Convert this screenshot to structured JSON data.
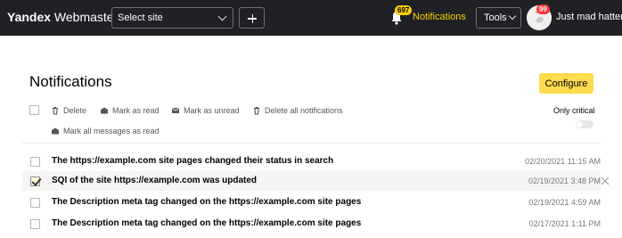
{
  "header": {
    "brand_bold": "Yandex",
    "brand_rest": " Webmaster",
    "site_select_label": "Select site",
    "notifications_count": "697",
    "notifications_label": "Notifications",
    "tools_label": "Tools",
    "avatar_badge": "99",
    "username": "Just mad hatter"
  },
  "page": {
    "title": "Notifications",
    "configure_label": "Configure"
  },
  "toolbar": {
    "delete": "Delete",
    "mark_read": "Mark as read",
    "mark_unread": "Mark as unread",
    "delete_all": "Delete all notifications",
    "mark_all_read": "Mark all messages as read",
    "only_critical": "Only critical"
  },
  "notifications": [
    {
      "title": "The https://example.com site pages changed their status in search",
      "time": "02/20/2021 11:15 AM",
      "checked": false
    },
    {
      "title": "SQI of the site https://example.com was updated",
      "time": "02/19/2021 3:48 PM",
      "checked": true
    },
    {
      "title": "The Description meta tag changed on the https://example.com site pages",
      "time": "02/19/2021 4:59 AM",
      "checked": false
    },
    {
      "title": "The Description meta tag changed on the https://example.com site pages",
      "time": "02/17/2021 1:11 PM",
      "checked": false
    }
  ],
  "colors": {
    "topbar": "#1f2125",
    "accent_yellow": "#ffdb4d",
    "notifications_link": "#ffcf01",
    "avatar_badge": "#ff3333"
  }
}
